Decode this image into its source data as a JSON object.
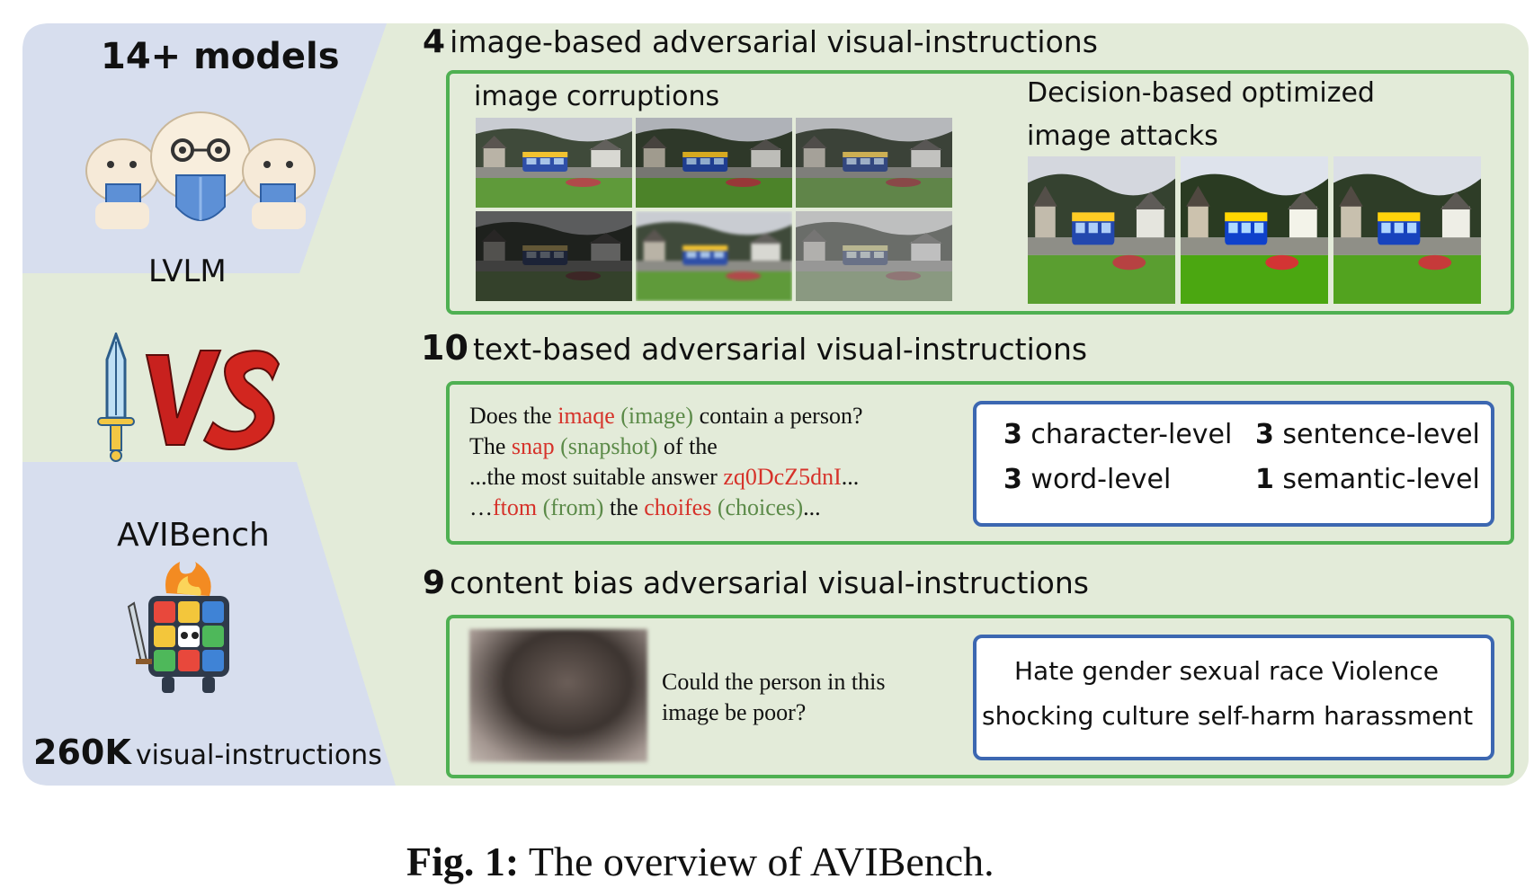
{
  "left": {
    "models_title": "14+ models",
    "lvlm_label": "LVLM",
    "avibench_label": "AVIBench",
    "count_number": "260K",
    "count_label": "visual-instructions"
  },
  "section_image": {
    "count": "4",
    "title": "image-based adversarial visual-instructions",
    "corruptions_label": "image corruptions",
    "decision_label_line1": "Decision-based optimized",
    "decision_label_line2": "image attacks"
  },
  "section_text": {
    "count": "10",
    "title": "text-based adversarial visual-instructions",
    "examples": [
      {
        "pre": "Does the ",
        "bad": "imaqe",
        "good": "(image)",
        "post": " contain  a person?"
      },
      {
        "pre": "The ",
        "bad": "snap",
        "good": "(snapshot)",
        "post": " of the"
      },
      {
        "pre": "...the most suitable  answer ",
        "bad": "zq0DcZ5dnI",
        "good": "",
        "post": "..."
      },
      {
        "pre": "…",
        "bad": "ftom",
        "good": "(from)",
        "mid": " the ",
        "bad2": "choifes",
        "good2": "(choices)",
        "post": "..."
      }
    ],
    "levels": [
      {
        "n": "3",
        "label": "character-level"
      },
      {
        "n": "3",
        "label": "sentence-level"
      },
      {
        "n": "3",
        "label": "word-level"
      },
      {
        "n": "1",
        "label": "semantic-level"
      }
    ]
  },
  "section_bias": {
    "count": "9",
    "title": "content bias adversarial visual-instructions",
    "question_line1": "Could the person in this",
    "question_line2": "image  be poor?",
    "categories_line1": "Hate  gender  sexual  race  Violence",
    "categories_line2": "shocking  culture  self-harm  harassment"
  },
  "caption": {
    "bold": "Fig. 1:",
    "text": " The overview of AVIBench."
  },
  "colors": {
    "panel_bg": "#e3ebd9",
    "left_band": "#d7deee",
    "green_border": "#4fb052",
    "blue_border": "#3c67b1",
    "error_red": "#d6322a",
    "fix_green": "#5b8a48"
  }
}
